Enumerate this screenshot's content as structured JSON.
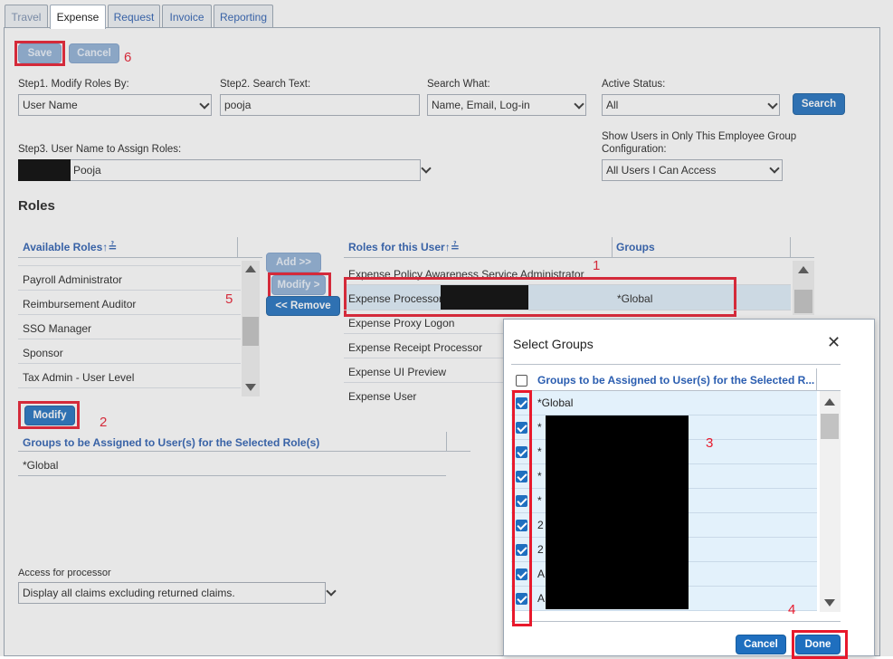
{
  "tabs": [
    {
      "label": "Travel"
    },
    {
      "label": "Expense"
    },
    {
      "label": "Request"
    },
    {
      "label": "Invoice"
    },
    {
      "label": "Reporting"
    }
  ],
  "toolbar": {
    "save": "Save",
    "cancel": "Cancel"
  },
  "filters": {
    "step1_label": "Step1. Modify Roles By:",
    "step1_value": "User Name",
    "step2_label": "Step2. Search Text:",
    "step2_value": "pooja",
    "search_what_label": "Search What:",
    "search_what_value": "Name, Email, Log-in",
    "active_label": "Active Status:",
    "active_value": "All",
    "search_button": "Search",
    "step3_label": "Step3. User Name to Assign Roles:",
    "step3_value": "Pooja",
    "group_config_label_1": "Show Users in Only This Employee Group",
    "group_config_label_2": "Configuration:",
    "group_config_value": "All Users I Can Access"
  },
  "roles": {
    "title": "Roles",
    "available_header": "Available Roles↑≟",
    "available": [
      "Payroll Administrator",
      "Reimbursement Auditor",
      "SSO Manager",
      "Sponsor",
      "Tax Admin - User Level"
    ],
    "add": "Add >>",
    "modify_arrow": "Modify >",
    "remove": "<< Remove",
    "modify": "Modify",
    "assigned_header": "Roles for this User↑≟",
    "groups_header": "Groups",
    "assigned": [
      {
        "name": "Expense Policy Awareness Service Administrator",
        "group": ""
      },
      {
        "name": "Expense Processor",
        "group": "*Global"
      },
      {
        "name": "Expense Proxy Logon",
        "group": ""
      },
      {
        "name": "Expense Receipt Processor",
        "group": ""
      },
      {
        "name": "Expense UI Preview",
        "group": ""
      },
      {
        "name": "Expense User",
        "group": ""
      }
    ],
    "groups_assigned_header": "Groups to be Assigned to User(s) for the Selected Role(s)",
    "groups_assigned": [
      "*Global"
    ],
    "access_label": "Access for processor",
    "access_value": "Display all claims excluding returned claims."
  },
  "modal": {
    "title": "Select Groups",
    "header": "Groups to be Assigned to User(s) for the Selected R...",
    "rows": [
      "*Global",
      "*",
      "*",
      "*",
      "*",
      "2",
      "2",
      "A",
      "A"
    ],
    "cancel": "Cancel",
    "done": "Done"
  },
  "annotations": [
    "1",
    "2",
    "3",
    "4",
    "5",
    "6"
  ],
  "colors": {
    "accent": "#1f6fbf",
    "highlight": "#e8192c",
    "link": "#2a5db0"
  }
}
